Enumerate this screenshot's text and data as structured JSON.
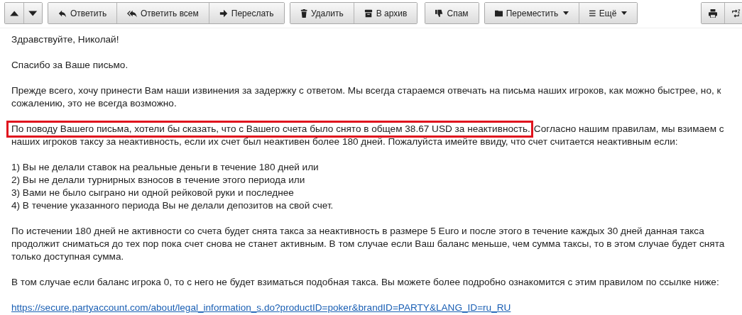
{
  "toolbar": {
    "groups": [
      [
        {
          "label": "Ответить"
        },
        {
          "label": "Ответить всем"
        },
        {
          "label": "Переслать"
        }
      ],
      [
        {
          "label": "Удалить"
        },
        {
          "label": "В архив"
        }
      ],
      [
        {
          "label": "Спам"
        }
      ],
      [
        {
          "label": "Переместить",
          "dropdown": true
        },
        {
          "label": "Ещё",
          "dropdown": true
        }
      ]
    ]
  },
  "message": {
    "paragraphs": [
      {
        "lines": [
          {
            "text": "Здравствуйте, Николай!"
          }
        ]
      },
      {
        "lines": [
          {
            "text": "Спасибо за Ваше письмо."
          }
        ]
      },
      {
        "lines": [
          {
            "text": "Прежде всего, хочу принести Вам наши извинения за задержку с ответом. Мы всегда стараемся отвечать на письма наших игроков, как можно быстрее, но, к"
          },
          {
            "text": "сожалению, это не всегда возможно."
          }
        ]
      },
      {
        "lines": [
          {
            "highlighted": "По поводу Вашего письма, хотели бы сказать, что с Вашего счета было снято в общем 38.67 USD за неактивность.",
            "text": "Согласно нашим правилам, мы взимаем с"
          },
          {
            "text": "наших игроков таксу за неактивность, если их счет был неактивен более 180 дней. Пожалуйста имейте ввиду, что счет считается неактивным если:"
          }
        ]
      },
      {
        "lines": [
          {
            "text": "1) Вы не делали ставок на реальные деньги в течение 180 дней или"
          },
          {
            "text": "2) Вы не делали турнирных взносов в течение этого периода или"
          },
          {
            "text": "3) Вами не было сыграно ни одной рейковой руки и последнее"
          },
          {
            "text": "4) В течение указанного периода Вы не делали депозитов на свой счет."
          }
        ]
      },
      {
        "lines": [
          {
            "text": "По истечении 180 дней не активности со счета будет снята такса за неактивность в размере 5 Euro и после этого в течение каждых 30 дней данная такса"
          },
          {
            "text": "продолжит сниматься до тех пор пока счет снова не станет активным. В том случае если Ваш баланс меньше, чем сумма таксы, то в этом случае будет снята"
          },
          {
            "text": "только доступная сумма."
          }
        ]
      },
      {
        "lines": [
          {
            "text": "В том случае если баланс игрока 0, то с него не будет взиматься подобная такса. Вы можете более подробно ознакомится с этим правилом по ссылке ниже:"
          }
        ]
      },
      {
        "kind": "link",
        "lines": [
          {
            "text": "https://secure.partyaccount.com/about/legal_information_s.do?productID=poker&brandID=PARTY&LANG_ID=ru_RU"
          }
        ]
      }
    ]
  }
}
